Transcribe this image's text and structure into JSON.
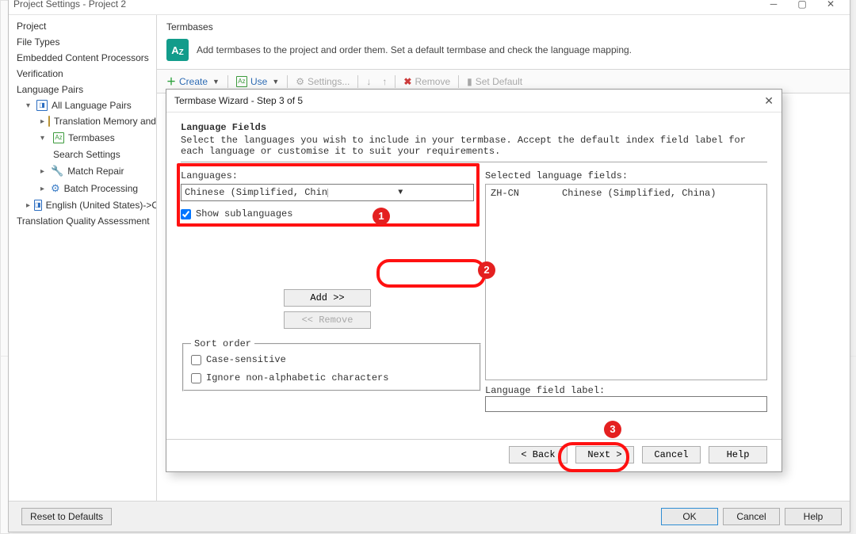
{
  "window": {
    "title": "Project Settings - Project 2"
  },
  "sidebar": {
    "items": [
      "Project",
      "File Types",
      "Embedded Content Processors",
      "Verification",
      "Language Pairs",
      "All Language Pairs",
      "Translation Memory and Aut",
      "Termbases",
      "Search Settings",
      "Match Repair",
      "Batch Processing",
      "English (United States)->Chinese",
      "Translation Quality Assessment"
    ]
  },
  "termbases": {
    "header": "Termbases",
    "desc": "Add termbases to the project and order them. Set a default termbase and check the language mapping.",
    "toolbar": {
      "create": "Create",
      "use": "Use",
      "settings": "Settings...",
      "remove": "Remove",
      "setdefault": "Set Default"
    }
  },
  "modal": {
    "title": "Termbase Wizard - Step 3 of 5",
    "heading": "Language Fields",
    "subtext": "Select the languages you wish to include in your termbase. Accept the default index field label for each language or customise it to suit your requirements.",
    "languages_label": "Languages:",
    "language_value": "Chinese (Simplified, China)",
    "show_sub": "Show sublanguages",
    "selected_label": "Selected language fields:",
    "selected_rows": [
      {
        "code": "ZH-CN",
        "name": "Chinese (Simplified, China)"
      }
    ],
    "add": "Add >>",
    "remove": "<< Remove",
    "sort_legend": "Sort order",
    "case_sensitive": "Case-sensitive",
    "ignore_nonalpha": "Ignore non-alphabetic characters",
    "field_label": "Language field label:",
    "back": "< Back",
    "next": "Next >",
    "cancel": "Cancel",
    "help": "Help"
  },
  "footer": {
    "reset": "Reset to Defaults",
    "ok": "OK",
    "cancel": "Cancel",
    "help": "Help"
  },
  "annotations": {
    "n1": "1",
    "n2": "2",
    "n3": "3"
  }
}
